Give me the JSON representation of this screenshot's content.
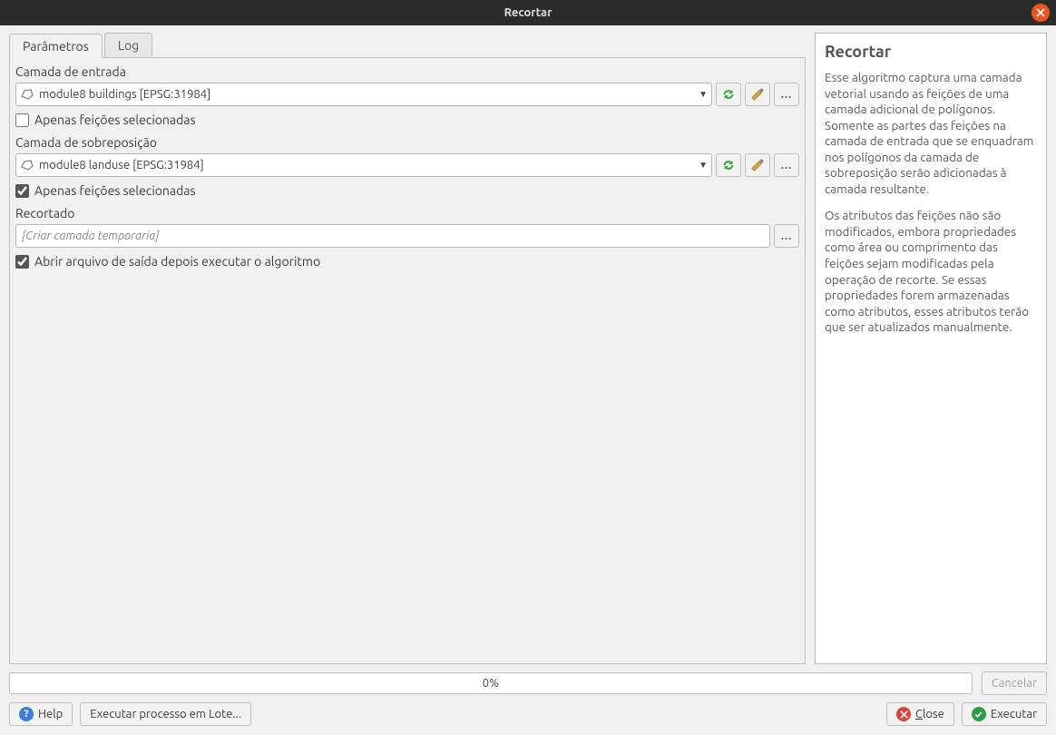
{
  "titlebar": {
    "title": "Recortar"
  },
  "tabs": {
    "parameters": "Parâmetros",
    "log": "Log"
  },
  "params": {
    "input_layer_label": "Camada de entrada",
    "input_layer_value": "module8 buildings [EPSG:31984]",
    "selected_only_1": "Apenas feições selecionadas",
    "overlay_layer_label": "Camada de sobreposição",
    "overlay_layer_value": "module8 landuse [EPSG:31984]",
    "selected_only_2": "Apenas feições selecionadas",
    "clipped_label": "Recortado",
    "clipped_placeholder": "[Criar camada temporaria]",
    "open_output": "Abrir arquivo de saída depois executar o algoritmo"
  },
  "help": {
    "title": "Recortar",
    "p1": "Esse algoritmo captura uma camada vetorial usando as feições de uma camada adicional de polígonos. Somente as partes das feições na camada de entrada que se enquadram nos polígonos da camada de sobreposição serão adicionadas à camada resultante.",
    "p2": "Os atributos das feições não são modificados, embora propriedades como área ou comprimento das feições sejam modificadas pela operação de recorte. Se essas propriedades forem armazenadas como atributos, esses atributos terão que ser atualizados manualmente."
  },
  "progress": {
    "text": "0%"
  },
  "buttons": {
    "cancel": "Cancelar",
    "help": "Help",
    "batch": "Executar processo em Lote...",
    "close": "Close",
    "run": "Executar"
  }
}
